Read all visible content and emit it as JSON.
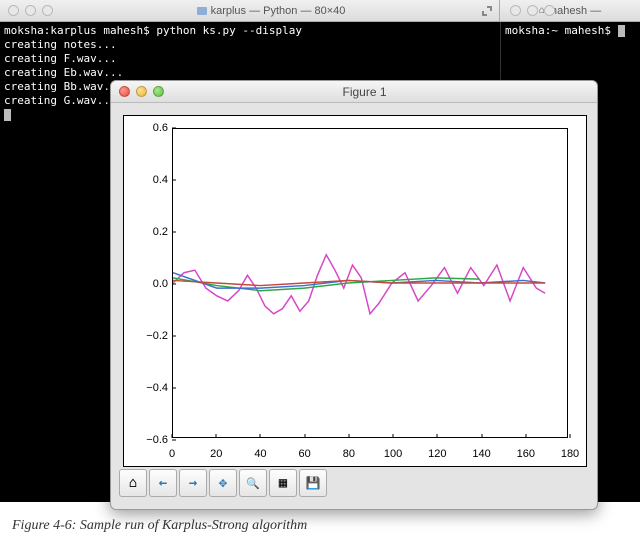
{
  "titlebar": {
    "left_title": "karplus — Python — 80×40",
    "right_title": "mahesh —"
  },
  "terminal_left": {
    "prompt": "moksha:karplus mahesh$ ",
    "command": "python ks.py --display",
    "lines": [
      "creating notes...",
      "creating F.wav...",
      "creating Eb.wav...",
      "creating Bb.wav...",
      "creating G.wav..."
    ]
  },
  "terminal_right": {
    "prompt": "moksha:~ mahesh$ "
  },
  "figure_window": {
    "title": "Figure 1",
    "toolbar": {
      "home": "⌂",
      "back": "←",
      "forward": "→",
      "pan": "✥",
      "zoom": "🔍",
      "subplots": "▦",
      "save": "💾"
    }
  },
  "chart_data": {
    "type": "line",
    "xlabel": "",
    "ylabel": "",
    "xlim": [
      0,
      180
    ],
    "ylim": [
      -0.6,
      0.6
    ],
    "xticks": [
      0,
      20,
      40,
      60,
      80,
      100,
      120,
      140,
      160,
      180
    ],
    "yticks": [
      -0.6,
      -0.4,
      -0.2,
      0.0,
      0.2,
      0.4,
      0.6
    ],
    "series": [
      {
        "name": "magenta",
        "color": "#d846c8",
        "x": [
          0,
          5,
          10,
          15,
          20,
          25,
          30,
          34,
          38,
          42,
          46,
          50,
          54,
          58,
          62,
          66,
          70,
          74,
          78,
          82,
          86,
          90,
          94,
          100,
          106,
          112,
          118,
          124,
          130,
          136,
          142,
          148,
          154,
          160,
          166,
          170
        ],
        "y": [
          0,
          0.04,
          0.05,
          -0.02,
          -0.05,
          -0.07,
          -0.03,
          0.03,
          -0.02,
          -0.09,
          -0.12,
          -0.1,
          -0.05,
          -0.11,
          -0.07,
          0.03,
          0.11,
          0.05,
          -0.02,
          0.07,
          0.02,
          -0.12,
          -0.08,
          0,
          0.04,
          -0.07,
          -0.01,
          0.06,
          -0.04,
          0.06,
          -0.01,
          0.07,
          -0.07,
          0.06,
          -0.02,
          -0.04
        ]
      },
      {
        "name": "green",
        "color": "#2fa648",
        "x": [
          0,
          20,
          40,
          60,
          80,
          100,
          120,
          140
        ],
        "y": [
          0.02,
          -0.01,
          -0.03,
          -0.02,
          0.0,
          0.01,
          0.02,
          0.015
        ]
      },
      {
        "name": "blue",
        "color": "#3d6fd2",
        "x": [
          0,
          20,
          40,
          60,
          80,
          100,
          120,
          140,
          160,
          170
        ],
        "y": [
          0.04,
          -0.02,
          -0.02,
          -0.01,
          0.01,
          0.0,
          0.01,
          0.0,
          0.01,
          0.0
        ]
      },
      {
        "name": "red",
        "color": "#c44a3a",
        "x": [
          0,
          20,
          40,
          60,
          80,
          100,
          120,
          140,
          160,
          170
        ],
        "y": [
          0.01,
          0.0,
          -0.01,
          0.0,
          0.01,
          0.0,
          0.0,
          0.0,
          0.0,
          0.0
        ]
      }
    ]
  },
  "caption": "Figure 4-6: Sample run of Karplus-Strong algorithm"
}
